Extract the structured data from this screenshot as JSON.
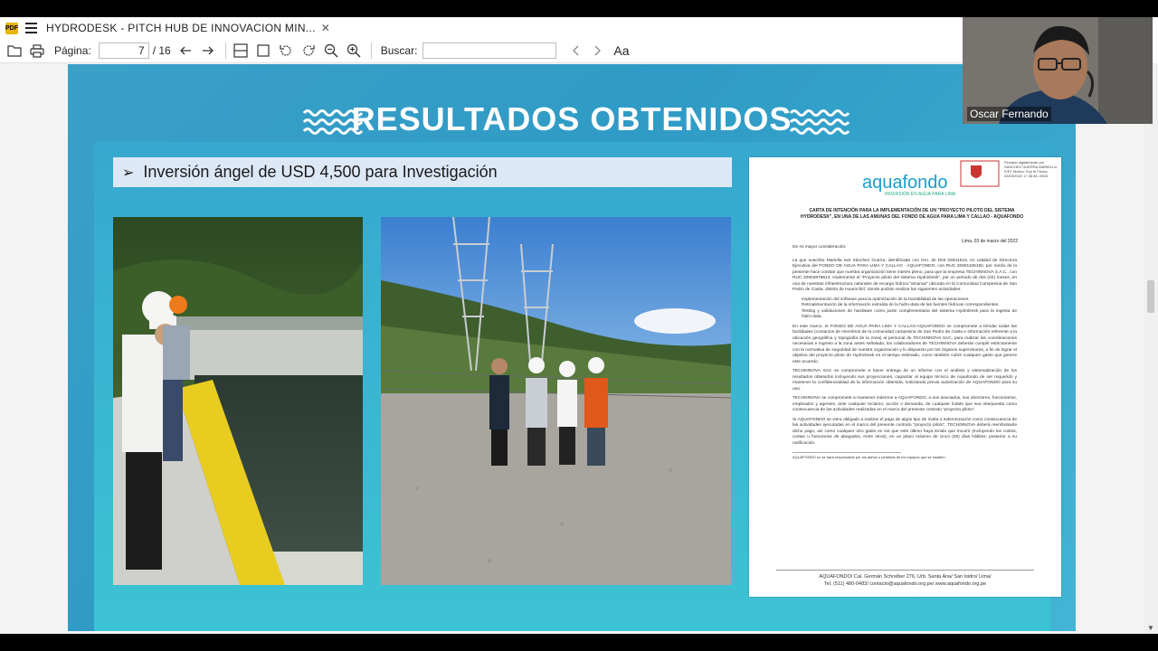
{
  "app": {
    "tab_title": "HYDRODESK - PITCH HUB DE INNOVACION MIN...",
    "close_symbol": "✕",
    "logo_text": "PDF"
  },
  "toolbar": {
    "page_label": "Página:",
    "current_page": "7",
    "total_pages": "/ 16",
    "search_label": "Buscar:",
    "search_value": "",
    "text_size_label": "Aa"
  },
  "slide": {
    "title": "RESULTADOS OBTENIDOS",
    "bullet": "Inversión ángel de USD 4,500 para Investigación",
    "bullet_marker": "➢"
  },
  "letter": {
    "brand": "aquafondo",
    "brand_sub": "INVERSIÓN EN AGUA PARA LIMA",
    "signature": "Firmado digitalmente por SANCHEZ GUERRA MARIELLA IVET Motivo: Soy fe Fecha: 03/03/2022 17:36:46 -0500",
    "heading": "CARTA DE INTENCIÓN PARA LA IMPLEMENTACIÓN DE UN \"PROYECTO PILOTO DEL SISTEMA HYDRODESK\", EN UNA DE LAS AMUNAS DEL FONDO DE AGUA PARA LIMA Y CALLAO - AQUAFONDO",
    "date": "Lima, 03 de marzo del 2022",
    "greeting": "De mi mayor consideración:",
    "p1": "La que suscribe Mariella Ivet Sánchez Guerra, identificada con Nro. de DNI 02841519, en calidad de Directora Ejecutiva del FONDO DE AGUA PARA LIMA Y CALLAO - AQUAFONDO, con RUC 20601106192, por medio de la presente hace constar que nuestra organización tiene interés pleno, para que la empresa TECHINNOVA S.A.C., con RUC 20603878613, implemente el \"Proyecto piloto del sistema HydroDesk\", por un periodo de dos (02) meses, en una de nuestras infraestructura naturales de recarga hídrica \"amunas\" ubicada en la Comunidad Campesina de San Pedro de Casta, distrito de Huarochirí; donde podrán realizar las siguientes actividades:",
    "li1": "Implementación del software para la optimización de la trazabilidad de las operaciones.",
    "li2": "Retroalimentación de la información extraída de la hidro-data de las fuentes hídricas correspondientes.",
    "li3": "Testing y validaciones de hardware como parte complementaria del sistema HydroDesk para la ingesta de hidro-data.",
    "p2": "En este marco, el FONDO DE AGUA PARA LIMA Y CALLAO-AQUAFONDO se compromete a brindar todas las facilidades (contactos de miembros de la comunidad campesina de San Pedro de Casta e información referente a la ubicación geográfica y topografía de la zona) al personal de TECHINNOVA SAC, para realizar las coordinaciones necesarias e ingreso a la zona antes señalada, los colaboradores de TECHINNOVA deberán cumplir estrictamente con la normativa de seguridad de nuestra organización y lo dispuesto por los órganos supervisores, a fin de lograr el objetivo del proyecto piloto de HydroDesk en el tiempo estimado, como también cubrir cualquier gasto que genere este acuerdo.",
    "p3": "TECHINNOVA SAC se compromete a hacer entrega de un informe con el análisis y sistematización de los resultados obtenidos incluyendo sus proyecciones, capacitar al equipo técnico de Aquafondo de ser requerido y mantener la confidencialidad de la información obtenida, solicitando previa autorización de AQUAFONDO para su uso.",
    "p4": "TECHINNOVA se compromete a mantener indemne a AQUAFONDO, a sus asociados, sus directores, funcionarios, empleados y agentes, ante cualquier reclamo, acción o demanda, de cualquier índole que sea interpuesta como consecuencia de las actividades realizadas en el marco del presente contrato \"proyecto piloto\".",
    "p5": "Si AQUAFONDO se viera obligado a realizar el pago de algún tipo de multa o indemnización como consecuencia de las actividades ejecutadas en el marco del presente contrato \"proyecto piloto\", TECHINNOVA deberá reembolsarle dicho pago, así como cualquier otro gasto en los que este último haya tenido que incurrir (incluyendo los costos, costas u honorarios de abogados, entre otros), en un plazo máximo de cinco (05) días hábiles, posterior a su notificación.",
    "footnote": "AQUAFONDO no se hará responsable por los daños o pérdidas de los equipos que se instalen.",
    "footer1": "AQUAFONDO/ Cal. Germán Schreiber 276, Urb. Santa Ana/ San Isidro/ Lima/",
    "footer2": "Tel. (511) 480-0483/ contacto@aquafondo.org.pe/ www.aquafondo.org.pe"
  },
  "webcam": {
    "name": "Oscar Fernando"
  },
  "colors": {
    "slide_blue": "#2f9bc6",
    "slide_teal": "#3cc3d3",
    "bullet_bg": "#dde8f6",
    "brand": "#1aa0c8"
  }
}
